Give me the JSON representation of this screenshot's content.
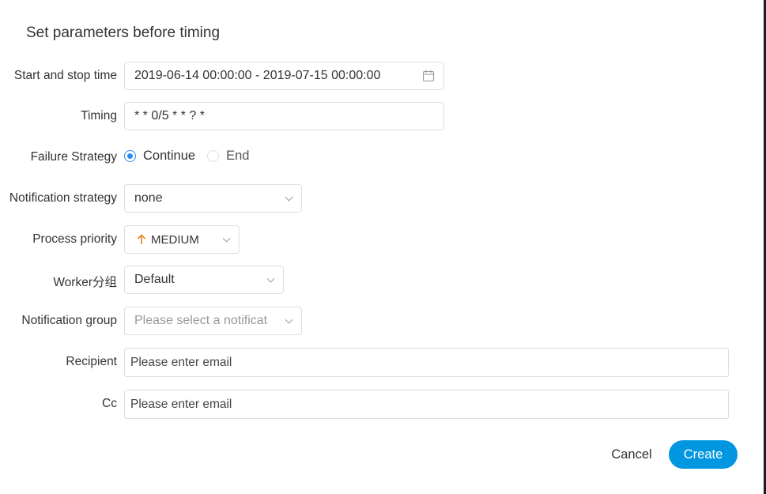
{
  "dialog": {
    "title": "Set parameters before timing"
  },
  "form": {
    "start_stop": {
      "label": "Start and stop time",
      "value": "2019-06-14 00:00:00 - 2019-07-15 00:00:00",
      "icon": "calendar-icon"
    },
    "timing": {
      "label": "Timing",
      "value": "* * 0/5 * * ? *"
    },
    "failure_strategy": {
      "label": "Failure Strategy",
      "options": [
        {
          "label": "Continue",
          "checked": true
        },
        {
          "label": "End",
          "checked": false
        }
      ]
    },
    "notification_strategy": {
      "label": "Notification strategy",
      "value": "none"
    },
    "process_priority": {
      "label": "Process priority",
      "value": "MEDIUM",
      "icon": "arrow-up-icon",
      "icon_color": "#e6801c"
    },
    "worker_group": {
      "label": "Worker分组",
      "value": "Default"
    },
    "notification_group": {
      "label": "Notification group",
      "placeholder": "Please select a notificat"
    },
    "recipient": {
      "label": "Recipient",
      "placeholder": "Please enter email"
    },
    "cc": {
      "label": "Cc",
      "placeholder": "Please enter email"
    }
  },
  "footer": {
    "cancel_label": "Cancel",
    "create_label": "Create"
  },
  "colors": {
    "primary": "#0097e0",
    "radio_accent": "#2d8cf0",
    "border": "#dcdee2"
  }
}
